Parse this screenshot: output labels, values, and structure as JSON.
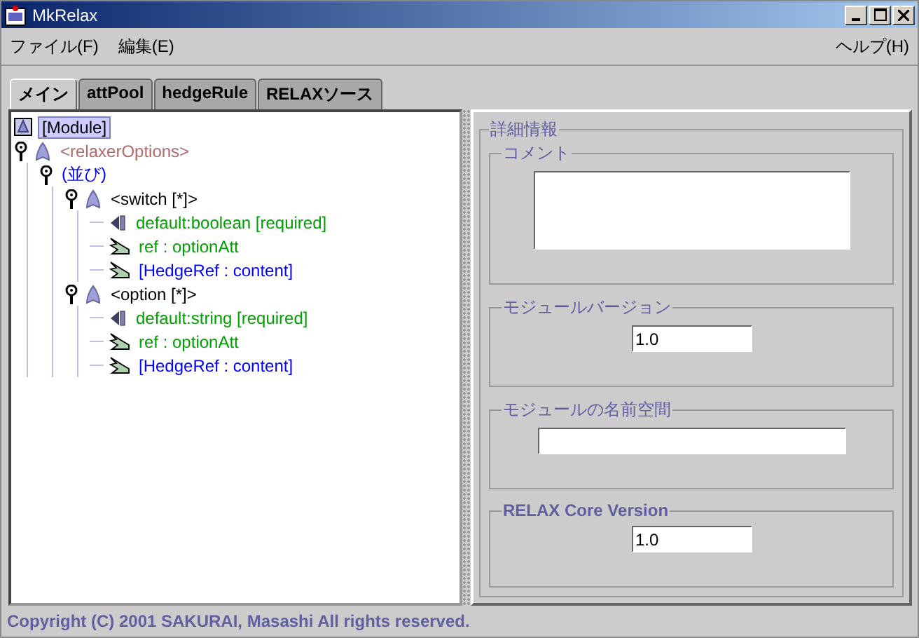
{
  "window": {
    "title": "MkRelax"
  },
  "menu": [
    {
      "label": "ファイル(F)"
    },
    {
      "label": "編集(E)"
    },
    {
      "label": "ヘルプ(H)"
    }
  ],
  "tabs": [
    {
      "label": "メイン",
      "selected": true
    },
    {
      "label": "attPool",
      "selected": false
    },
    {
      "label": "hedgeRule",
      "selected": false
    },
    {
      "label": "RELAXソース",
      "selected": false
    }
  ],
  "tree": [
    {
      "kind": "module",
      "label": "[Module]",
      "selected": true,
      "children": [
        {
          "kind": "root",
          "label": "<relaxerOptions>",
          "selected": false,
          "expanded": true,
          "children": [
            {
              "kind": "sequence",
              "label": "(並び)",
              "selected": false,
              "expanded": true,
              "children": [
                {
                  "kind": "element",
                  "label": "<switch [*]>",
                  "selected": false,
                  "expanded": true,
                  "children": [
                    {
                      "kind": "attribute",
                      "label": "default:boolean [required]",
                      "selected": false
                    },
                    {
                      "kind": "ref",
                      "label": "ref : optionAtt",
                      "selected": false
                    },
                    {
                      "kind": "hedgeref",
                      "label": "[HedgeRef : content]",
                      "selected": false
                    }
                  ]
                },
                {
                  "kind": "element",
                  "label": "<option [*]>",
                  "selected": false,
                  "expanded": true,
                  "children": [
                    {
                      "kind": "attribute",
                      "label": "default:string [required]",
                      "selected": false
                    },
                    {
                      "kind": "ref",
                      "label": "ref : optionAtt",
                      "selected": false
                    },
                    {
                      "kind": "hedgeref",
                      "label": "[HedgeRef : content]",
                      "selected": false
                    }
                  ]
                }
              ]
            }
          ]
        }
      ]
    }
  ],
  "details": {
    "title": "詳細情報",
    "groups": [
      {
        "label": "コメント",
        "kind": "textarea"
      },
      {
        "label": "モジュールバージョン",
        "kind": "short",
        "value": "1.0"
      },
      {
        "label": "モジュールの名前空間",
        "kind": "wide"
      },
      {
        "label": "RELAX Core Version",
        "kind": "short",
        "value": "1.0"
      }
    ]
  },
  "status_bar": "Copyright (C) 2001 SAKURAI, Masashi  All rights reserved."
}
